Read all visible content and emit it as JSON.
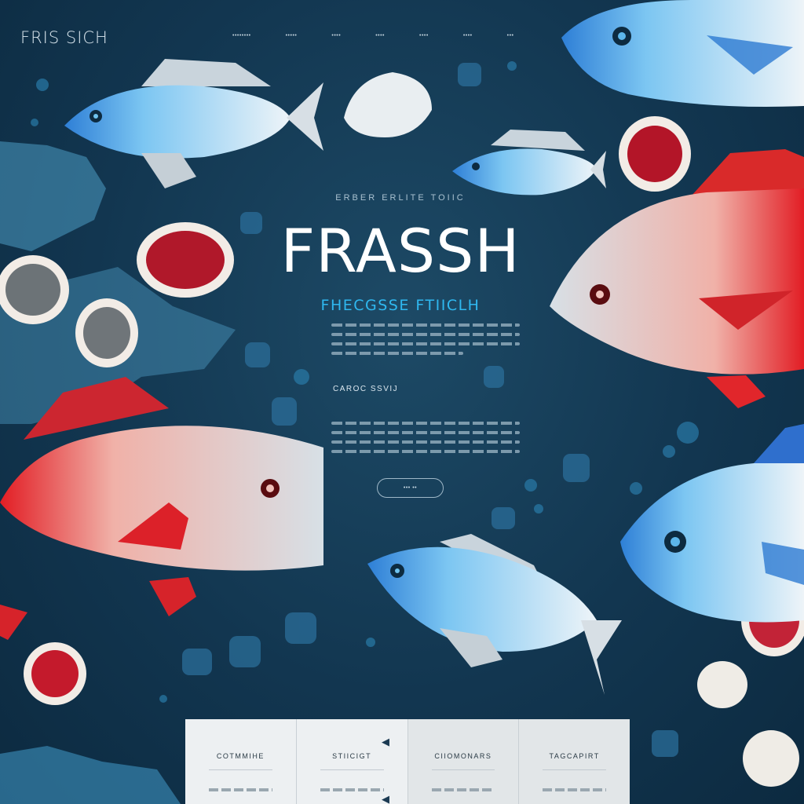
{
  "header": {
    "logo": "FRIS SICH",
    "nav": [
      "••••••••",
      "•••••",
      "••••",
      "••••",
      "••••",
      "••••",
      "•••"
    ]
  },
  "hero": {
    "eyebrow": "ERBER  ERLITE  TOIIC",
    "title": "FRASSH",
    "subtitle": "FHECGSSE FTIICLH"
  },
  "section": {
    "heading": "CAROC SSVIJ"
  },
  "cta": {
    "label": "••• ••"
  },
  "cards": [
    {
      "title": "COTMMIHE"
    },
    {
      "title": "STIICIGT"
    },
    {
      "title": "CIIOMONARS"
    },
    {
      "title": "TAGCAPIRT"
    }
  ],
  "colors": {
    "background": "#123650",
    "accent_blue": "#2fb8f0",
    "accent_red": "#e52a2a"
  }
}
